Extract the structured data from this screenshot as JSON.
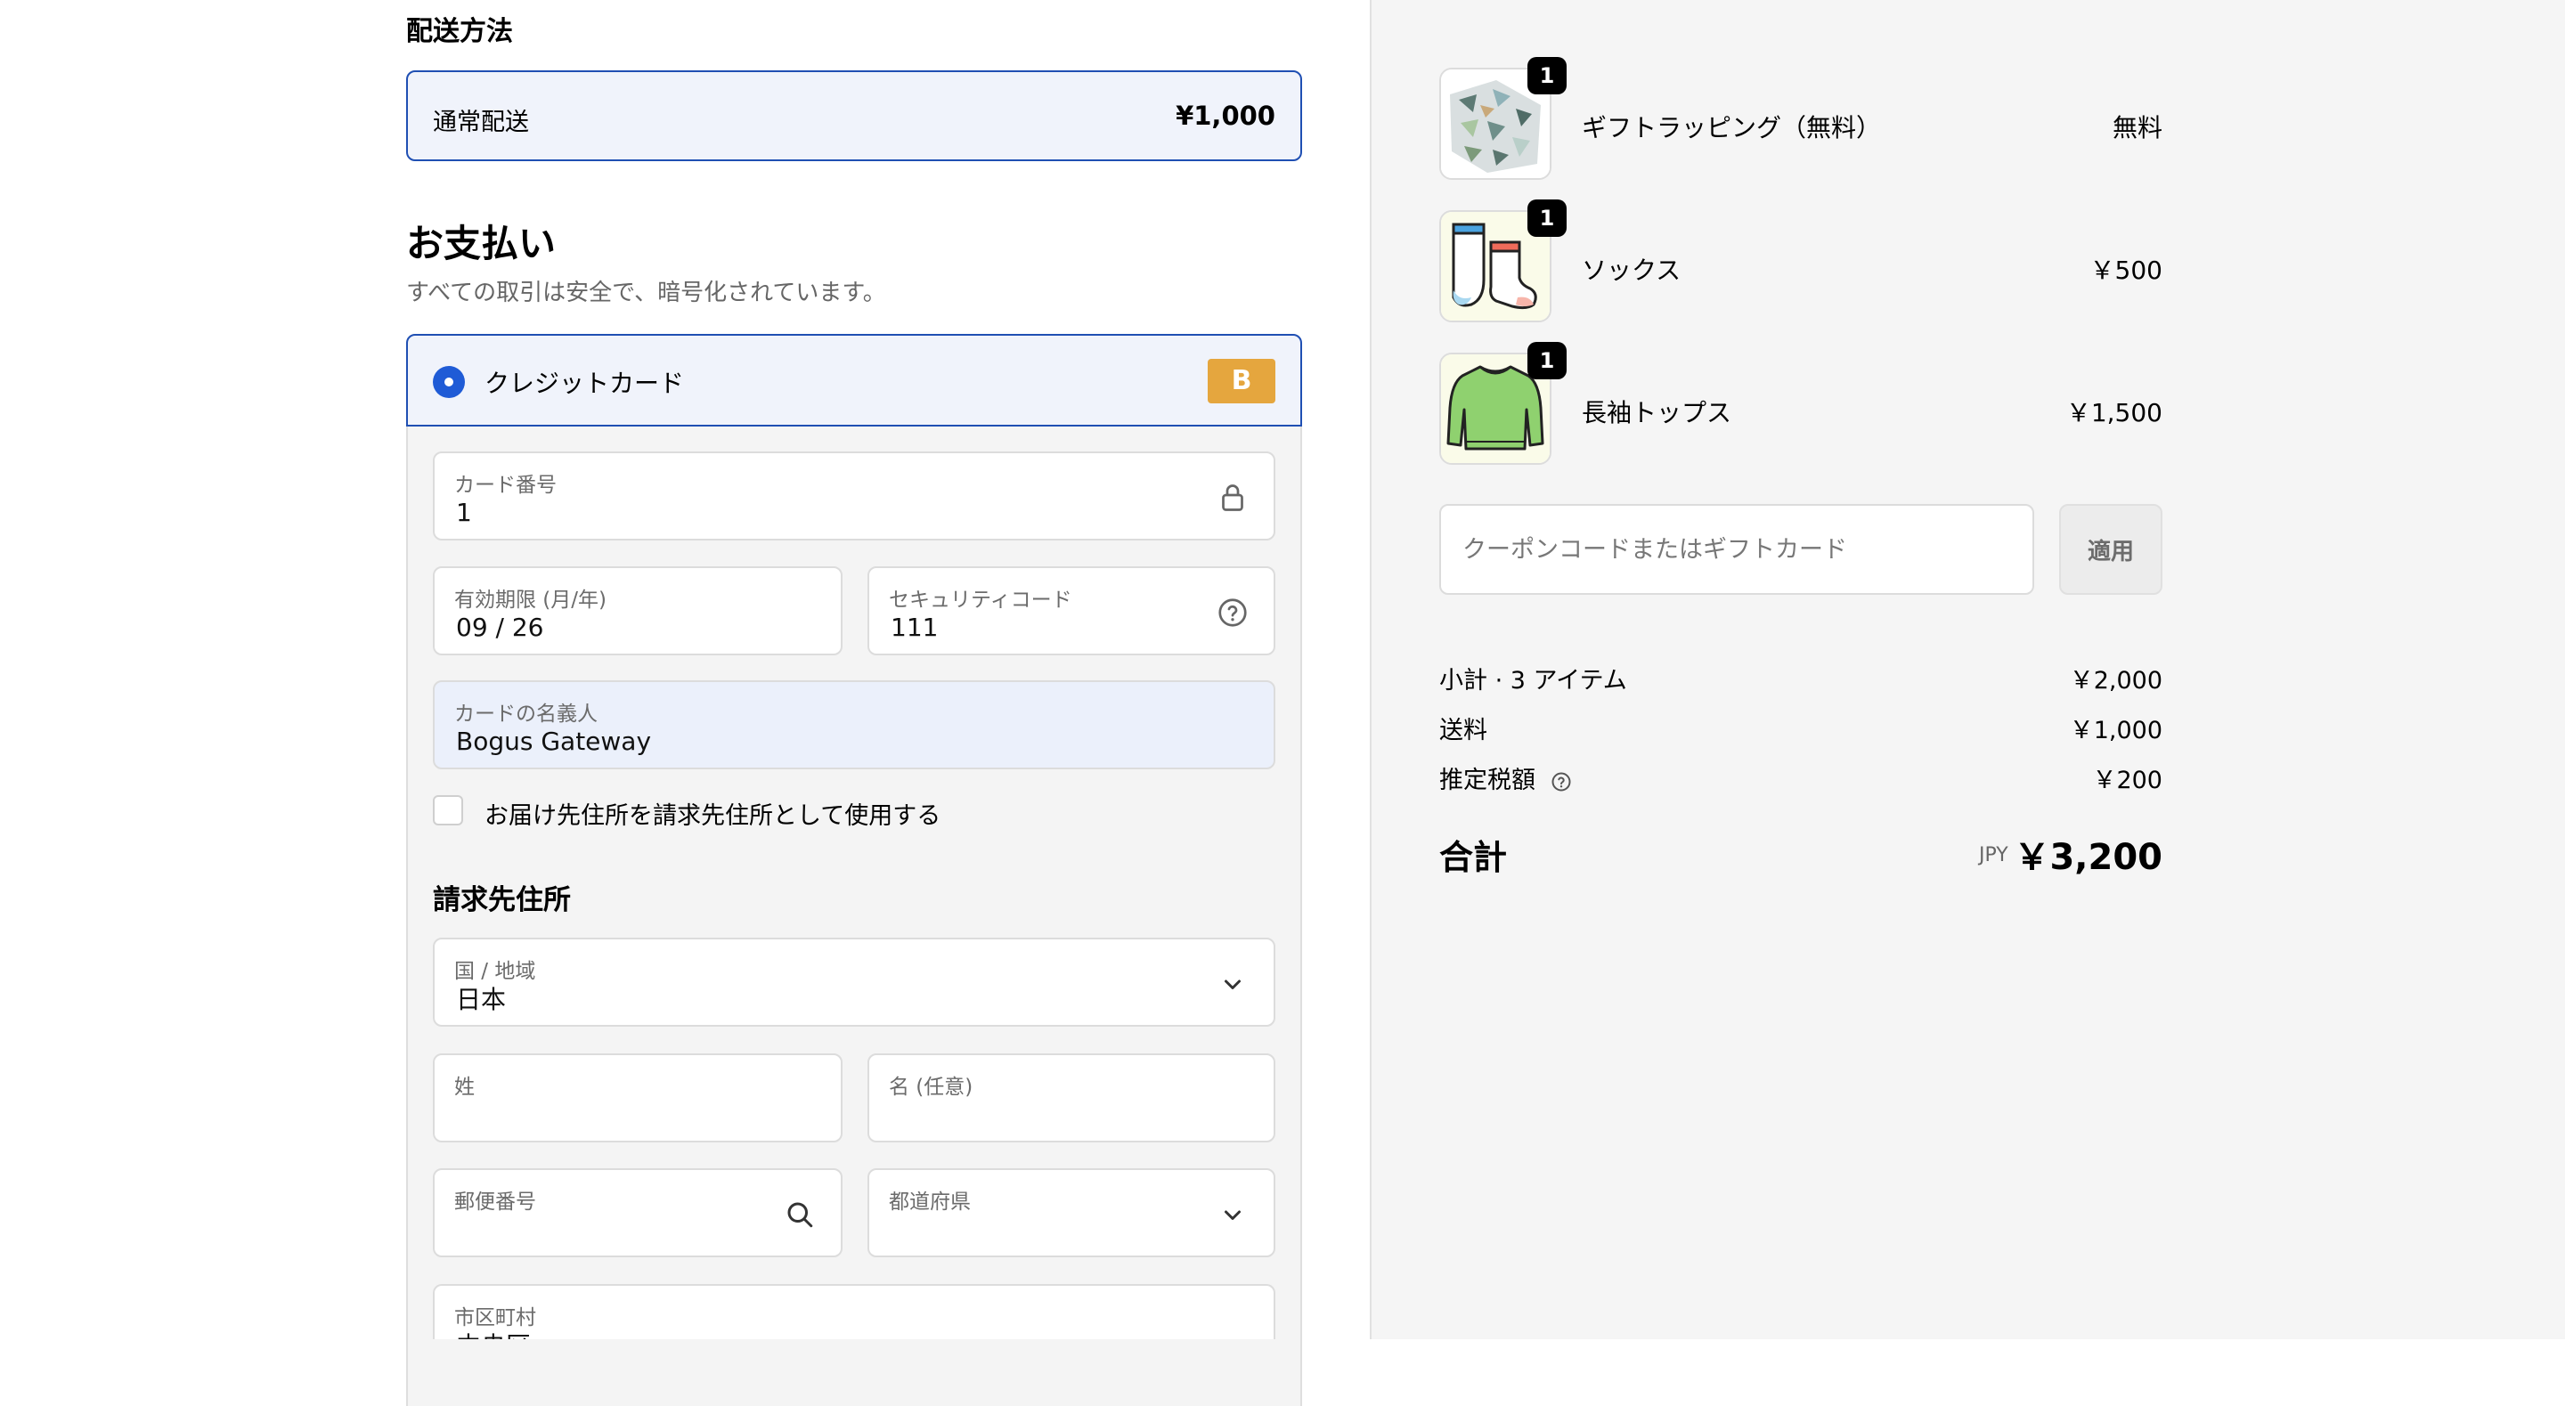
{
  "shipping": {
    "title": "配送方法",
    "method": "通常配送",
    "price": "¥1,000"
  },
  "payment": {
    "title": "お支払い",
    "subtitle": "すべての取引は安全で、暗号化されています。",
    "method_label": "クレジットカード",
    "badge": "B",
    "card_number": {
      "label": "カード番号",
      "value": "1"
    },
    "expiry": {
      "label": "有効期限 (月/年)",
      "value": "09 / 26"
    },
    "security": {
      "label": "セキュリティコード",
      "value": "111"
    },
    "card_name": {
      "label": "カードの名義人",
      "value": "Bogus Gateway"
    },
    "same_address_label": "お届け先住所を請求先住所として使用する"
  },
  "billing": {
    "title": "請求先住所",
    "country": {
      "label": "国 / 地域",
      "value": "日本"
    },
    "last_name": {
      "label": "姓",
      "value": ""
    },
    "first_name": {
      "label": "名 (任意)",
      "value": ""
    },
    "postal": {
      "label": "郵便番号",
      "value": ""
    },
    "prefecture": {
      "label": "都道府県",
      "value": ""
    },
    "city": {
      "label": "市区町村",
      "value": "中央区"
    }
  },
  "cart": {
    "items": [
      {
        "name": "ギフトラッピング（無料）",
        "price": "無料",
        "qty": "1"
      },
      {
        "name": "ソックス",
        "price": "￥500",
        "qty": "1"
      },
      {
        "name": "長袖トップス",
        "price": "￥1,500",
        "qty": "1"
      }
    ],
    "coupon_placeholder": "クーポンコードまたはギフトカード",
    "apply_label": "適用",
    "subtotal_label": "小計 · 3 アイテム",
    "subtotal": "￥2,000",
    "shipping_label": "送料",
    "shipping": "￥1,000",
    "tax_label": "推定税額",
    "tax": "￥200",
    "total_label": "合計",
    "currency": "JPY",
    "total": "￥3,200"
  }
}
